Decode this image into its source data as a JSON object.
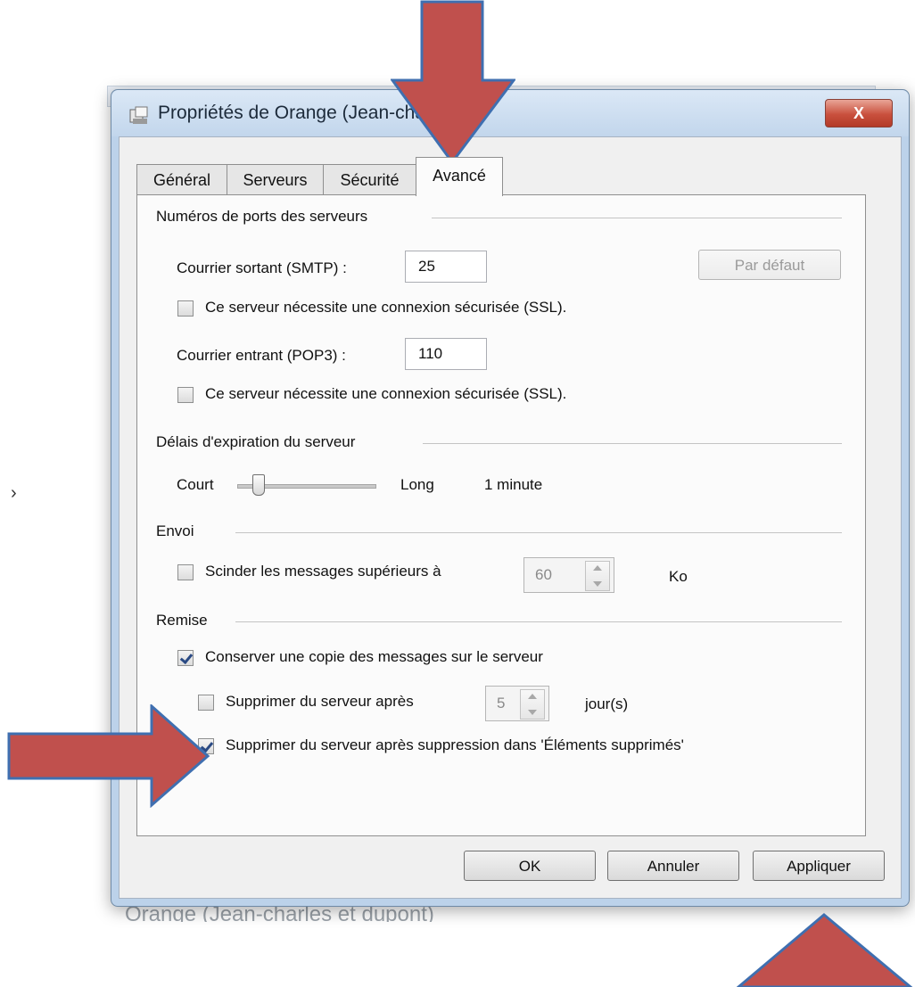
{
  "background": {
    "bottom_fragment": "Orange (Jean-charles et dupont)",
    "side_glyph": "›"
  },
  "window": {
    "title": "Propriétés de Orange (Jean-charles)",
    "close_label": "X"
  },
  "tabs": [
    {
      "label": "Général"
    },
    {
      "label": "Serveurs"
    },
    {
      "label": "Sécurité"
    },
    {
      "label": "Avancé",
      "selected": true
    }
  ],
  "ports": {
    "group_title": "Numéros de ports des serveurs",
    "smtp_label": "Courrier sortant (SMTP) :",
    "smtp_value": "25",
    "default_button": "Par défaut",
    "ssl_smtp": {
      "label": "Ce serveur nécessite une connexion sécurisée (SSL).",
      "checked": false
    },
    "pop3_label": "Courrier entrant (POP3) :",
    "pop3_value": "110",
    "ssl_pop3": {
      "label": "Ce serveur nécessite une connexion sécurisée (SSL).",
      "checked": false
    }
  },
  "timeout": {
    "group_title": "Délais d'expiration du serveur",
    "short_label": "Court",
    "long_label": "Long",
    "value_text": "1 minute",
    "slider_fraction": 0.15
  },
  "send": {
    "group_title": "Envoi",
    "split": {
      "label": "Scinder les messages supérieurs à",
      "checked": false
    },
    "split_value": "60",
    "unit": "Ko"
  },
  "delivery": {
    "group_title": "Remise",
    "keep_copy": {
      "label": "Conserver une copie des messages sur le serveur",
      "checked": true
    },
    "delete_after": {
      "label": "Supprimer du serveur après",
      "checked": false
    },
    "days_value": "5",
    "days_unit": "jour(s)",
    "delete_when_deleted": {
      "label": "Supprimer du serveur après suppression dans 'Éléments supprimés'",
      "checked": true
    }
  },
  "buttons": {
    "ok": "OK",
    "cancel": "Annuler",
    "apply": "Appliquer"
  },
  "annotation_color": "#c0504d"
}
